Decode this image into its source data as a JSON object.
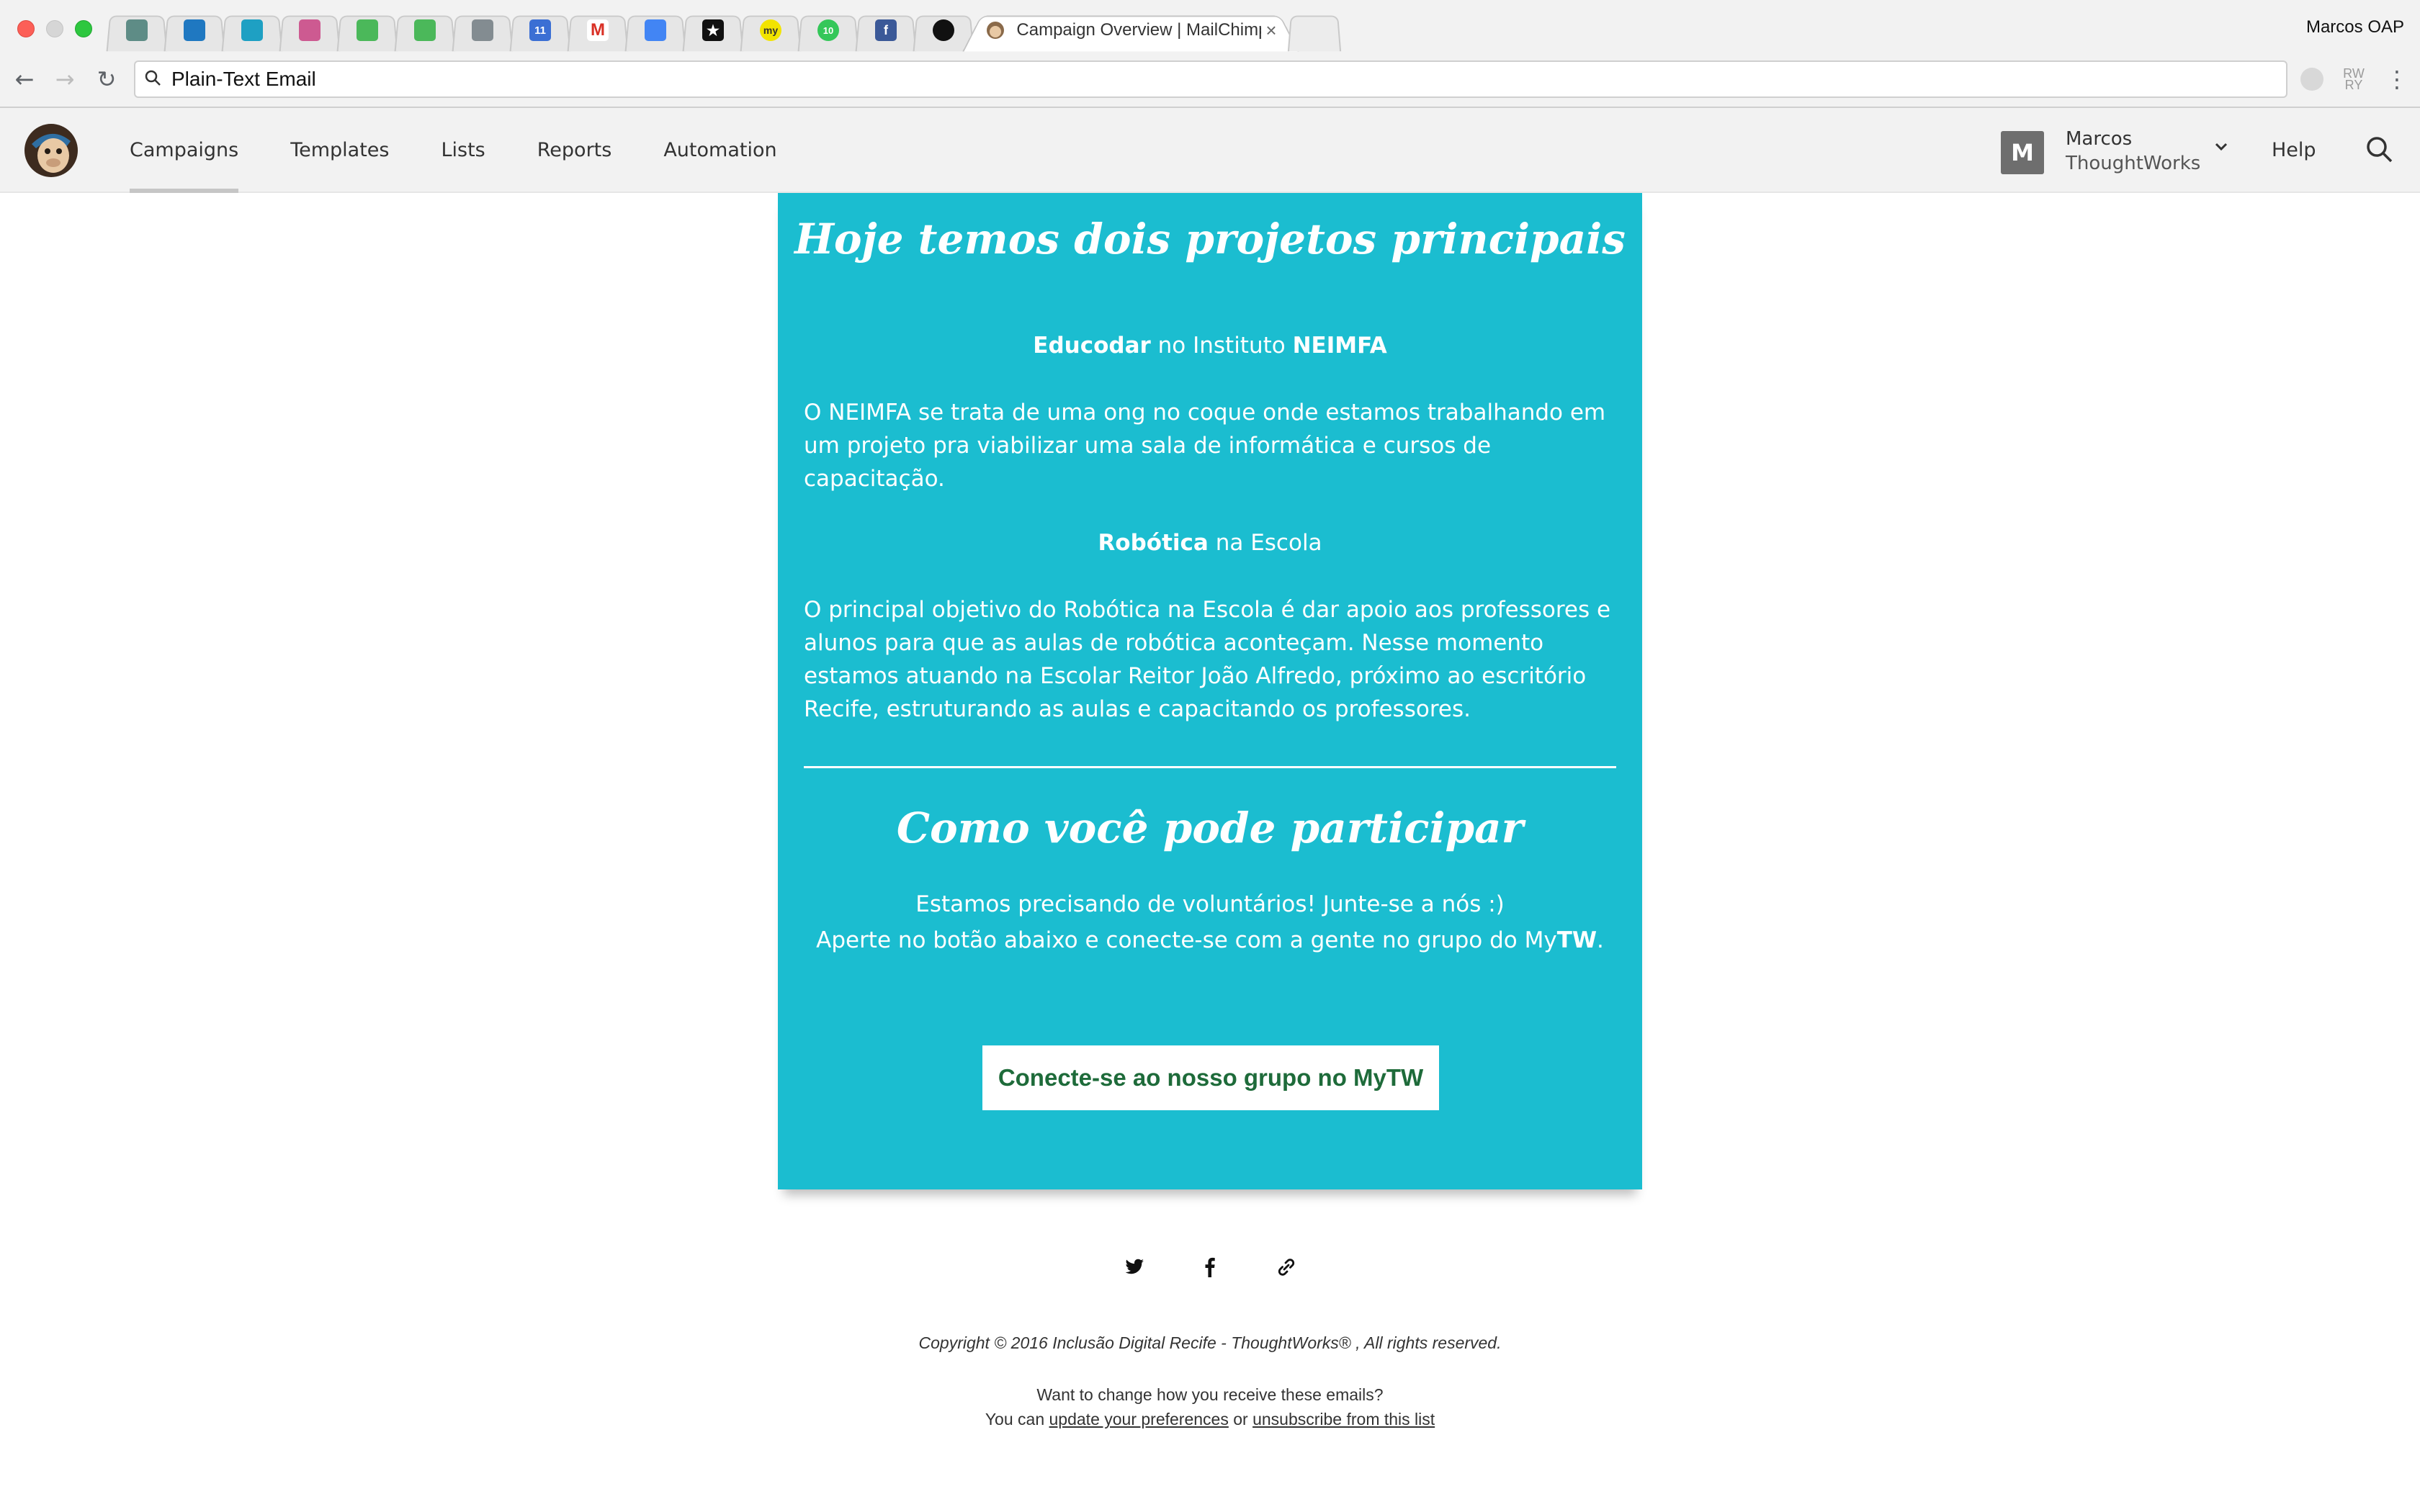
{
  "browser": {
    "tabs": [
      {
        "icon": "trello-icon",
        "color": "#5e8c86"
      },
      {
        "icon": "trello-icon",
        "color": "#1f78c1"
      },
      {
        "icon": "trello-icon",
        "color": "#1ea0c3"
      },
      {
        "icon": "trello-icon",
        "color": "#cd5a91"
      },
      {
        "icon": "trello-icon",
        "color": "#4bb85a"
      },
      {
        "icon": "trello-icon",
        "color": "#4bb85a"
      },
      {
        "icon": "trello-icon",
        "color": "#838c91"
      },
      {
        "icon": "calendar-icon",
        "color": "#3b6fd4",
        "label": "11"
      },
      {
        "icon": "gmail-icon",
        "color": "#ffffff",
        "label": "M"
      },
      {
        "icon": "inbox-icon",
        "color": "#4285f4"
      },
      {
        "icon": "star-icon",
        "color": "#111111"
      },
      {
        "icon": "my-icon",
        "color": "#f2e400",
        "label": "my"
      },
      {
        "icon": "badge-icon",
        "color": "#34c759",
        "label": "10"
      },
      {
        "icon": "facebook-icon",
        "color": "#3b5998",
        "label": "f"
      },
      {
        "icon": "github-icon",
        "color": "#111111"
      }
    ],
    "active_tab": {
      "title": "Campaign Overview | MailChimp",
      "close": "×"
    },
    "profile_name": "Marcos OAP",
    "address_bar": "Plain-Text Email"
  },
  "header": {
    "nav": [
      "Campaigns",
      "Templates",
      "Lists",
      "Reports",
      "Automation"
    ],
    "active_nav": "Campaigns",
    "avatar_letter": "M",
    "user_name": "Marcos",
    "user_org": "ThoughtWorks",
    "help": "Help"
  },
  "email": {
    "heading1": "Hoje temos dois projetos principais",
    "project1_title_bold1": "Educodar",
    "project1_title_mid": " no Instituto ",
    "project1_title_bold2": "NEIMFA",
    "project1_text": "O NEIMFA se trata de uma ong no coque onde estamos trabalhando em um projeto pra viabilizar uma sala de informática e cursos de capacitação.",
    "project2_title_bold": "Robótica",
    "project2_title_rest": " na Escola",
    "project2_text": "O principal objetivo do Robótica na Escola é dar apoio aos professores e alunos para que as aulas de robótica aconteçam. Nesse momento estamos atuando na Escolar Reitor João Alfredo, próximo ao escritório Recife, estruturando as aulas e capacitando os professores.",
    "heading2": "Como você pode participar",
    "line1": "Estamos precisando de voluntários! Junte-se a nós :)",
    "line2_prefix": "Aperte no botão abaixo e conecte-se com a gente no grupo do My",
    "line2_bold": "TW",
    "line2_suffix": ".",
    "cta_label": "Conecte-se ao nosso grupo no MyTW",
    "background_color": "#1bbdd0",
    "cta_text_color": "#1e6b3a"
  },
  "footer": {
    "copyright": "Copyright © 2016 Inclusão Digital Recife - ThoughtWorks® , All rights reserved.",
    "change_text": "Want to change how you receive these emails?",
    "you_can": "You can ",
    "update_link": "update your preferences",
    "or": " or ",
    "unsubscribe_link": "unsubscribe from this list"
  }
}
